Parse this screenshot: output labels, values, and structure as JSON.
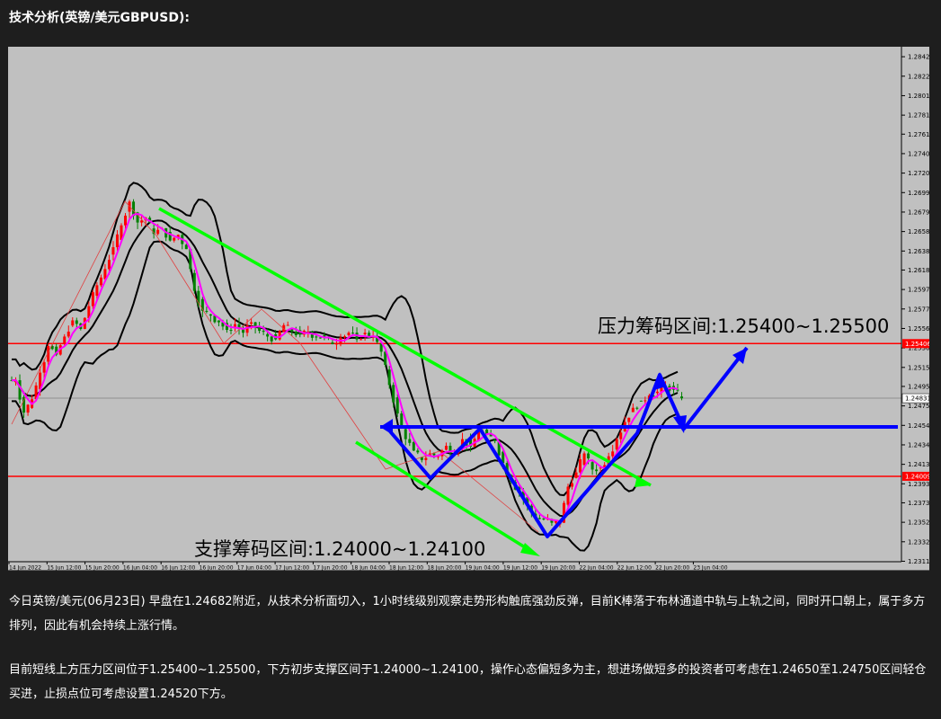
{
  "heading": "技术分析(英镑/美元GBPUSD):",
  "chart_data": {
    "type": "candlestick",
    "title": "",
    "ylim": [
      1.2311,
      1.2853
    ],
    "colors": {
      "background": "#c0c0c0",
      "up_candle": "#ff0000",
      "down_candle": "#008000",
      "bollinger": "#000000",
      "moving_average": "#ff00ff",
      "horizontal_levels": "#ff0000",
      "trend_channel": "#00ff00",
      "arrows": "#0000ff"
    },
    "y_ticks": [
      "1.28425",
      "1.28220",
      "1.28015",
      "1.27810",
      "1.27610",
      "1.27405",
      "1.27200",
      "1.26995",
      "1.26790",
      "1.26585",
      "1.26380",
      "1.26180",
      "1.25975",
      "1.25770",
      "1.25565",
      "1.25360",
      "1.25155",
      "1.24955",
      "1.24750",
      "1.24545",
      "1.24340",
      "1.24135",
      "1.23930",
      "1.23730",
      "1.23525",
      "1.23320",
      "1.23115"
    ],
    "x_ticks": [
      "14 Jun 2022",
      "15 Jun 12:00",
      "15 Jun 20:00",
      "16 Jun 04:00",
      "16 Jun 12:00",
      "16 Jun 20:00",
      "17 Jun 04:00",
      "17 Jun 12:00",
      "17 Jun 20:00",
      "18 Jun 04:00",
      "18 Jun 12:00",
      "18 Jun 20:00",
      "19 Jun 04:00",
      "19 Jun 12:00",
      "19 Jun 20:00",
      "22 Jun 04:00",
      "22 Jun 12:00",
      "22 Jun 20:00",
      "23 Jun 04:00"
    ],
    "x_tick_labels_display": [
      "14 Jun 2022",
      "15 Jun 12:00",
      "15 Jun 20:00",
      "16 Jun 04:00",
      "16 Jun 12:00",
      "16 Jun 20:00",
      "17 Jun 04:00",
      "17 Jun 12:00",
      "17 Jun 20:00",
      "18 Jun 04:00",
      "18 Jun 12:00",
      "18 Jun 20:00",
      "19 Jun 04:00",
      "19 Jun 12:00",
      "19 Jun 20:00",
      "22 Jun 04:00",
      "22 Jun 12:00",
      "22 Jun 20:00",
      "23 Jun 04:00"
    ],
    "current_price": "1.24831",
    "resistance_level": "1.25406",
    "support_level": "1.24009",
    "resistance_label": "压力筹码区间:1.25400~1.25500",
    "support_label": "支撑筹码区间:1.24000~1.24100",
    "price_path": [
      1.2502,
      1.2468,
      1.2482,
      1.251,
      1.2538,
      1.2529,
      1.2548,
      1.2565,
      1.2556,
      1.258,
      1.2602,
      1.2619,
      1.2642,
      1.2665,
      1.269,
      1.2668,
      1.2673,
      1.2656,
      1.2662,
      1.2649,
      1.2655,
      1.264,
      1.2596,
      1.2575,
      1.257,
      1.2563,
      1.2555,
      1.2561,
      1.2552,
      1.2563,
      1.2554,
      1.2548,
      1.2545,
      1.256,
      1.2553,
      1.255,
      1.2553,
      1.2547,
      1.2548,
      1.254,
      1.2547,
      1.2552,
      1.2545,
      1.2552,
      1.2548,
      1.2532,
      1.2497,
      1.2467,
      1.244,
      1.2428,
      1.2418,
      1.2425,
      1.2422,
      1.2433,
      1.2425,
      1.244,
      1.2432,
      1.2448,
      1.2445,
      1.2438,
      1.2415,
      1.2395,
      1.2385,
      1.237,
      1.2357,
      1.2356,
      1.2352,
      1.2352,
      1.239,
      1.2405,
      1.2425,
      1.2408,
      1.241,
      1.2422,
      1.244,
      1.2458,
      1.2473,
      1.248,
      1.2486,
      1.249,
      1.2496,
      1.2492,
      1.2483
    ]
  },
  "paragraphs": [
    "今日英镑/美元(06月23日) 早盘在1.24682附近，从技术分析面切入，1小时线级别观察走势形构触底强劲反弹，目前K棒落于布林通道中轨与上轨之间，同时开口朝上，属于多方排列，因此有机会持续上涨行情。",
    "目前短线上方压力区间位于1.25400~1.25500，下方初步支撑区间于1.24000~1.24100，操作心态偏短多为主，想进场做短多的投资者可考虑在1.24650至1.24750区间轻仓买进，止损点位可考虑设置1.24520下方。"
  ]
}
